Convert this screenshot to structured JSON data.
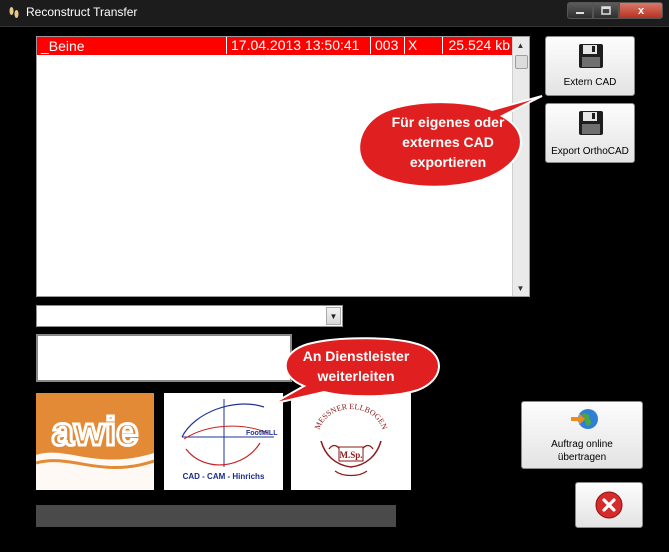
{
  "window": {
    "title": "Reconstruct Transfer",
    "controls": {
      "minimize_icon": "minimize-icon",
      "maximize_icon": "maximize-icon",
      "close_label": "x"
    }
  },
  "list": {
    "rows": [
      {
        "name": "_Beine",
        "date": "17.04.2013 13:50:41",
        "number": "003",
        "flag": "X",
        "size": "25.524 kb"
      }
    ]
  },
  "combo": {
    "selected": ""
  },
  "textfield": {
    "value": ""
  },
  "buttons": {
    "extern_cad": {
      "label": "Extern CAD",
      "icon": "floppy-disk-icon"
    },
    "export_orthocad": {
      "label": "Export OrthoCAD",
      "icon": "floppy-disk-icon"
    },
    "online": {
      "label_line1": "Auftrag online",
      "label_line2": "übertragen",
      "icon": "globe-arrow-icon"
    },
    "close": {
      "icon": "red-close-icon"
    }
  },
  "callouts": {
    "export": {
      "line1": "Für eigenes oder",
      "line2": "externes CAD",
      "line3": "exportieren"
    },
    "dienstleister": {
      "line1": "An Dienstleister",
      "line2": "weiterleiten"
    }
  },
  "logos": {
    "awie": "awie",
    "footmill_curve_label": "FootMILL",
    "footmill_caption": "CAD - CAM - Hinrichs",
    "ellbogen_initials": "M.Sp.",
    "ellbogen_arc": "MESSNER ELLBOGEN"
  },
  "colors": {
    "selected_row": "#ff0000",
    "callout_fill": "#e02020",
    "awie_orange": "#e28a35"
  }
}
